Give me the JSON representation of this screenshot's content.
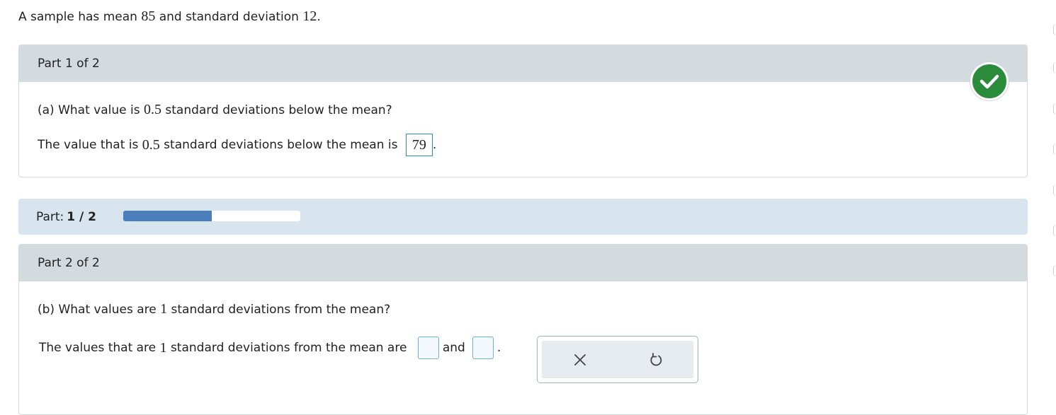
{
  "intro": {
    "prefix": "A sample has mean ",
    "mean": "85",
    "middle": " and standard deviation ",
    "sd": "12",
    "suffix": "."
  },
  "part1": {
    "header": "Part 1 of 2",
    "question": {
      "prefix": "(a) What value is ",
      "k": "0.5",
      "suffix": " standard deviations below the mean?"
    },
    "answer_line": {
      "prefix": "The value that is ",
      "k": "0.5",
      "suffix": " standard deviations below the mean is ",
      "answer": "79",
      "end": "."
    },
    "status_icon": "check-circle-icon",
    "status_color": "#2a8b3a"
  },
  "progress": {
    "label": "Part: ",
    "value_text": "1 / 2",
    "fraction": 0.5,
    "fill_color": "#4a7fbb"
  },
  "part2": {
    "header": "Part 2 of 2",
    "question": {
      "prefix": "(b) What values are ",
      "k": "1",
      "suffix": " standard deviations from the mean?"
    },
    "answer_line": {
      "prefix": "The values that are ",
      "k": "1",
      "suffix": " standard deviations from the mean are ",
      "and": "and",
      "end": "."
    },
    "tools": {
      "clear_icon": "close-icon",
      "reset_icon": "undo-icon"
    }
  }
}
